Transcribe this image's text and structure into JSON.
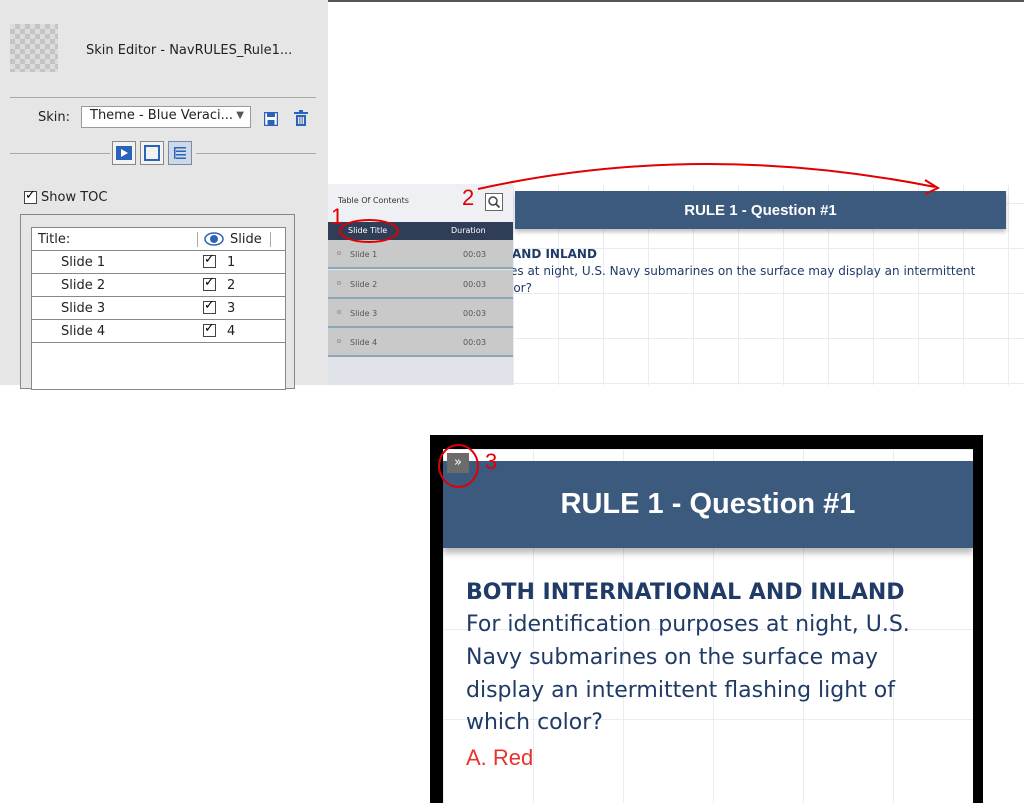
{
  "skin_editor": {
    "title": "Skin Editor - NavRULES_Rule1...",
    "skin_label": "Skin:",
    "skin_value": "Theme - Blue Veraci...",
    "show_toc_label": "Show TOC",
    "show_toc_checked": true,
    "toc_table": {
      "header_title": "Title:",
      "header_slide": "Slide",
      "rows": [
        {
          "title": "Slide 1",
          "visible": true,
          "slide": "1"
        },
        {
          "title": "Slide 2",
          "visible": true,
          "slide": "2"
        },
        {
          "title": "Slide 3",
          "visible": true,
          "slide": "3"
        },
        {
          "title": "Slide 4",
          "visible": true,
          "slide": "4"
        }
      ]
    }
  },
  "toc_preview": {
    "title": "Table Of Contents",
    "col_title": "Slide Title",
    "col_duration": "Duration",
    "items": [
      {
        "title": "Slide 1",
        "duration": "00:03"
      },
      {
        "title": "Slide 2",
        "duration": "00:03"
      },
      {
        "title": "Slide 3",
        "duration": "00:03"
      },
      {
        "title": "Slide 4",
        "duration": "00:03"
      }
    ]
  },
  "slide_small": {
    "banner_title": "RULE 1 - Question #1",
    "question_head": "AND INLAND",
    "question_line1": "es at night, U.S. Navy submarines on the surface may display an intermittent",
    "question_line2": "lor?"
  },
  "slide_large": {
    "toggle_icon": "»",
    "banner_title": "RULE 1 - Question #1",
    "question_head": "BOTH INTERNATIONAL AND INLAND",
    "question_lines": [
      "For identification purposes at night, U.S.",
      "Navy submarines on the surface may",
      "display an intermittent flashing light of",
      "which color?"
    ],
    "answer": "A. Red"
  },
  "annotations": {
    "marker_1": "1",
    "marker_2": "2",
    "marker_3": "3",
    "color": "#e00000"
  },
  "colors": {
    "banner": "#3b5a7e",
    "toc_header": "#2f3d57",
    "question_text": "#1f3b66",
    "answer_text": "#e8322d"
  }
}
